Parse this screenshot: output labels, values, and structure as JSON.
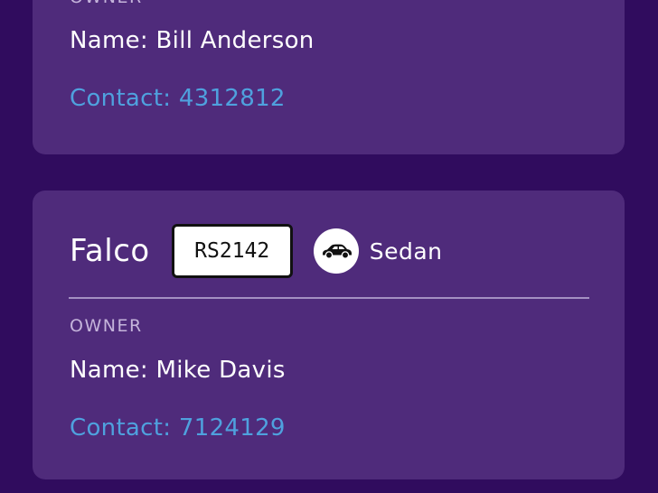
{
  "cards": [
    {
      "owner": {
        "label": "OWNER",
        "name": "Name: Bill Anderson",
        "contact": "Contact: 4312812"
      }
    },
    {
      "vehicle": {
        "model": "Falco",
        "plate": "RS2142",
        "type": "Sedan",
        "type_icon": "car-icon"
      },
      "owner": {
        "label": "OWNER",
        "name": "Name: Mike Davis",
        "contact": "Contact: 7124129"
      }
    }
  ],
  "colors": {
    "background": "#300c5e",
    "card": "#4f2b7b",
    "contact_link": "#4fa1de",
    "label": "#c5b4db"
  }
}
